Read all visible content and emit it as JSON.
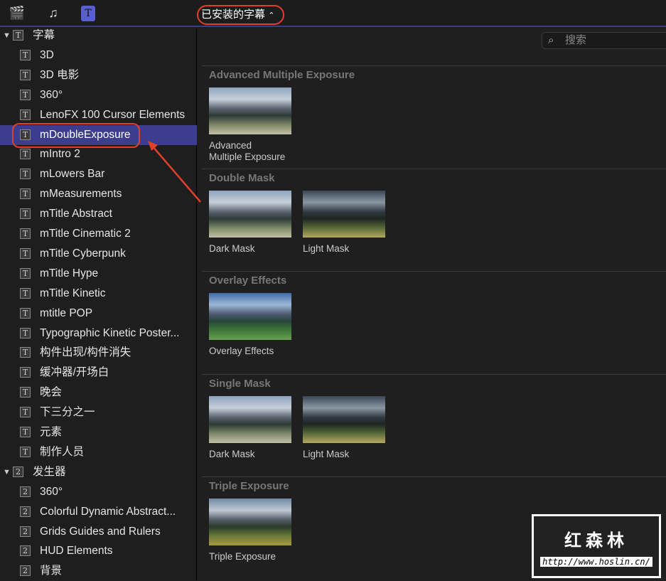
{
  "toolbar": {
    "icons": [
      "clapper-star-icon",
      "music-photo-icon",
      "titles-icon"
    ],
    "popup_label": "已安装的字幕 ⌃"
  },
  "popup": {
    "label": "已安装的字幕",
    "chevron": "⌃⌄"
  },
  "sidebar": {
    "groups": [
      {
        "label": "字幕",
        "icon": "T",
        "items": [
          "3D",
          "3D 电影",
          "360°",
          "LenoFX 100 Cursor Elements",
          "mDoubleExposure",
          "mIntro 2",
          "mLowers Bar",
          "mMeasurements",
          "mTitle Abstract",
          "mTitle Cinematic 2",
          "mTitle Cyberpunk",
          "mTitle Hype",
          "mTitle Kinetic",
          "mtitle POP",
          "Typographic Kinetic Poster...",
          "构件出现/构件消失",
          "缓冲器/开场白",
          "晚会",
          "下三分之一",
          "元素",
          "制作人员"
        ]
      },
      {
        "label": "发生器",
        "icon": "2",
        "items": [
          "360°",
          "Colorful Dynamic Abstract...",
          "Grids Guides and Rulers",
          "HUD Elements",
          "背景"
        ]
      }
    ],
    "selected": "mDoubleExposure"
  },
  "search": {
    "placeholder": "搜索"
  },
  "sections": [
    {
      "title": "Advanced Multiple Exposure",
      "items": [
        {
          "label": "Advanced\nMultiple Exposure",
          "style": "normal"
        }
      ]
    },
    {
      "title": "Double Mask",
      "items": [
        {
          "label": "Dark Mask",
          "style": "normal"
        },
        {
          "label": "Light Mask",
          "style": "dark"
        }
      ]
    },
    {
      "title": "Overlay Effects",
      "items": [
        {
          "label": "Overlay Effects",
          "style": "ov"
        }
      ]
    },
    {
      "title": "Single Mask",
      "items": [
        {
          "label": "Dark Mask",
          "style": "normal"
        },
        {
          "label": "Light Mask",
          "style": "dark"
        }
      ]
    },
    {
      "title": "Triple Exposure",
      "items": [
        {
          "label": "Triple Exposure",
          "style": "tri"
        }
      ]
    }
  ],
  "watermark": {
    "title": "红森林",
    "url": "http://www.hoslin.cn/"
  }
}
